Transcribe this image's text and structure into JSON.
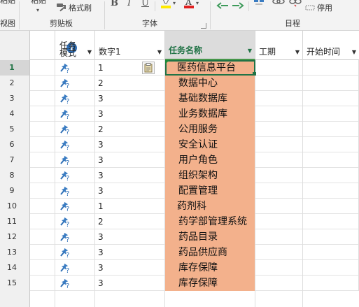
{
  "ribbon": {
    "partial_left_top": "粘贴",
    "partial_left_bottom": "视图",
    "partial_second_top": "粘贴",
    "format_painter": "格式刷",
    "clipboard_group": "剪贴板",
    "bold": "B",
    "italic": "I",
    "underline": "U",
    "font_group": "字体",
    "deactivate": "停用",
    "schedule_group": "日程"
  },
  "header": {
    "info": "i",
    "mode": "任务模式",
    "number1": "数字1",
    "task_name": "任务名称",
    "duration": "工期",
    "start": "开始时间"
  },
  "rows": [
    {
      "id": "1",
      "num": "1",
      "name": "医药信息平台"
    },
    {
      "id": "2",
      "num": "2",
      "name": "数据中心"
    },
    {
      "id": "3",
      "num": "3",
      "name": "基础数据库"
    },
    {
      "id": "4",
      "num": "3",
      "name": "业务数据库"
    },
    {
      "id": "5",
      "num": "2",
      "name": "公用服务"
    },
    {
      "id": "6",
      "num": "3",
      "name": "安全认证"
    },
    {
      "id": "7",
      "num": "3",
      "name": "用户角色"
    },
    {
      "id": "8",
      "num": "3",
      "name": "组织架构"
    },
    {
      "id": "9",
      "num": "3",
      "name": "配置管理"
    },
    {
      "id": "10",
      "num": "1",
      "name": "药剂科"
    },
    {
      "id": "11",
      "num": "2",
      "name": "药学部管理系统"
    },
    {
      "id": "12",
      "num": "3",
      "name": "药品目录"
    },
    {
      "id": "13",
      "num": "3",
      "name": "药品供应商"
    },
    {
      "id": "14",
      "num": "3",
      "name": "库存保障"
    },
    {
      "id": "15",
      "num": "3",
      "name": "库存保障"
    }
  ],
  "colors": {
    "task_fill": "#f3b18c",
    "accent_green": "#217346",
    "pin_blue": "#3a7cc2"
  },
  "icons": {
    "mode": "manual-schedule-pin-icon",
    "paste_options": "paste-options-icon",
    "info": "info-icon"
  }
}
